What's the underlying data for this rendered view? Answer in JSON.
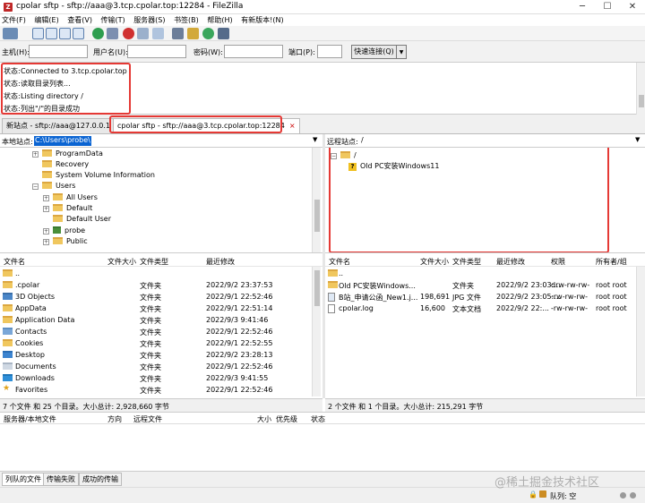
{
  "window": {
    "title": "cpolar sftp - sftp://aaa@3.tcp.cpolar.top:12284 - FileZilla",
    "icon": "filezilla-icon"
  },
  "menu": [
    "文件(F)",
    "编辑(E)",
    "查看(V)",
    "传输(T)",
    "服务器(S)",
    "书签(B)",
    "帮助(H)",
    "有新版本!(N)"
  ],
  "quickconnect": {
    "host_label": "主机(H):",
    "user_label": "用户名(U):",
    "pass_label": "密码(W):",
    "port_label": "端口(P):",
    "host_value": "",
    "user_value": "",
    "pass_value": "",
    "port_value": "",
    "connect_label": "快速连接(Q)"
  },
  "log": [
    {
      "label": "状态:",
      "text": "Connected to 3.tcp.cpolar.top"
    },
    {
      "label": "状态:",
      "text": "读取目录列表..."
    },
    {
      "label": "状态:",
      "text": "Listing directory /"
    },
    {
      "label": "状态:",
      "text": "列出\"/\"的目录成功"
    }
  ],
  "tabs": [
    {
      "label": "新站点 - sftp://aaa@127.0.0.1",
      "close": "×"
    },
    {
      "label": "cpolar sftp - sftp://aaa@3.tcp.cpolar.top:12284",
      "close": "×"
    }
  ],
  "local": {
    "path_label": "本地站点:",
    "path_value": "C:\\Users\\probe\\",
    "tree": [
      {
        "label": "ProgramData",
        "indent": 1,
        "expander": "+"
      },
      {
        "label": "Recovery",
        "indent": 1,
        "expander": ""
      },
      {
        "label": "System Volume Information",
        "indent": 1,
        "expander": ""
      },
      {
        "label": "Users",
        "indent": 1,
        "expander": "−"
      },
      {
        "label": "All Users",
        "indent": 2,
        "expander": "+"
      },
      {
        "label": "Default",
        "indent": 2,
        "expander": "+"
      },
      {
        "label": "Default User",
        "indent": 2,
        "expander": ""
      },
      {
        "label": "probe",
        "indent": 2,
        "expander": "+"
      },
      {
        "label": "Public",
        "indent": 2,
        "expander": "+"
      }
    ],
    "columns": [
      "文件名",
      "文件大小",
      "文件类型",
      "最近修改"
    ],
    "files": [
      {
        "name": "..",
        "size": "",
        "type": "",
        "modified": ""
      },
      {
        "name": ".cpolar",
        "size": "",
        "type": "文件夹",
        "modified": "2022/9/2 23:37:53"
      },
      {
        "name": "3D Objects",
        "size": "",
        "type": "文件夹",
        "modified": "2022/9/1 22:52:46"
      },
      {
        "name": "AppData",
        "size": "",
        "type": "文件夹",
        "modified": "2022/9/1 22:51:14"
      },
      {
        "name": "Application Data",
        "size": "",
        "type": "文件夹",
        "modified": "2022/9/3 9:41:46"
      },
      {
        "name": "Contacts",
        "size": "",
        "type": "文件夹",
        "modified": "2022/9/1 22:52:46"
      },
      {
        "name": "Cookies",
        "size": "",
        "type": "文件夹",
        "modified": "2022/9/1 22:52:55"
      },
      {
        "name": "Desktop",
        "size": "",
        "type": "文件夹",
        "modified": "2022/9/2 23:28:13"
      },
      {
        "name": "Documents",
        "size": "",
        "type": "文件夹",
        "modified": "2022/9/1 22:52:46"
      },
      {
        "name": "Downloads",
        "size": "",
        "type": "文件夹",
        "modified": "2022/9/3 9:41:55"
      },
      {
        "name": "Favorites",
        "size": "",
        "type": "文件夹",
        "modified": "2022/9/1 22:52:46"
      }
    ],
    "status": "7 个文件 和 25 个目录。大小总计: 2,928,660 字节"
  },
  "remote": {
    "path_label": "远程站点:",
    "path_value": "/",
    "tree": [
      {
        "label": "/",
        "indent": 1,
        "expander": "−",
        "kind": "folder"
      },
      {
        "label": "Old PC安装Windows11",
        "indent": 2,
        "expander": "",
        "kind": "unknown"
      }
    ],
    "columns": [
      "文件名",
      "文件大小",
      "文件类型",
      "最近修改",
      "权限",
      "所有者/组"
    ],
    "files": [
      {
        "name": "..",
        "size": "",
        "type": "",
        "modified": "",
        "perms": "",
        "owner": "",
        "icon": "folder"
      },
      {
        "name": "Old PC安装Windows...",
        "size": "",
        "type": "文件夹",
        "modified": "2022/9/2 23:03:...",
        "perms": "drw-rw-rw-",
        "owner": "root root",
        "icon": "folder"
      },
      {
        "name": "B站_申请公函_New1.j...",
        "size": "198,691",
        "type": "JPG 文件",
        "modified": "2022/9/2 23:05:...",
        "perms": "-rw-rw-rw-",
        "owner": "root root",
        "icon": "image"
      },
      {
        "name": "cpolar.log",
        "size": "16,600",
        "type": "文本文档",
        "modified": "2022/9/2 22:...",
        "perms": "-rw-rw-rw-",
        "owner": "root root",
        "icon": "doc"
      }
    ],
    "status": "2 个文件 和 1 个目录。大小总计: 215,291 字节"
  },
  "queue": {
    "columns": [
      "服务器/本地文件",
      "方向",
      "远程文件",
      "大小",
      "优先级",
      "状态"
    ],
    "tabs": [
      "列队的文件",
      "传输失败",
      "成功的传输"
    ],
    "queue_status": "队列: 空"
  },
  "watermark": "@稀土掘金技术社区",
  "colors": {
    "highlight": "#e53935",
    "selection": "#0a64d2",
    "folder": "#f0c75e"
  }
}
